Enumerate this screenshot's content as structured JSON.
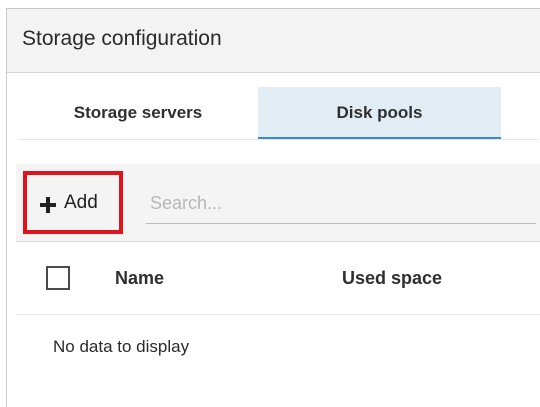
{
  "window": {
    "title": "Storage configuration"
  },
  "tabs": [
    {
      "label": "Storage servers",
      "active": false
    },
    {
      "label": "Disk pools",
      "active": true
    }
  ],
  "toolbar": {
    "add_label": "Add",
    "add_icon": "plus-icon",
    "search_placeholder": "Search..."
  },
  "table": {
    "columns": [
      "Name",
      "Used space"
    ],
    "empty_message": "No data to display"
  },
  "colors": {
    "active_tab_background": "#e1ecf5",
    "active_tab_underline": "#3a8ad1",
    "highlight_border": "#e0121c"
  }
}
